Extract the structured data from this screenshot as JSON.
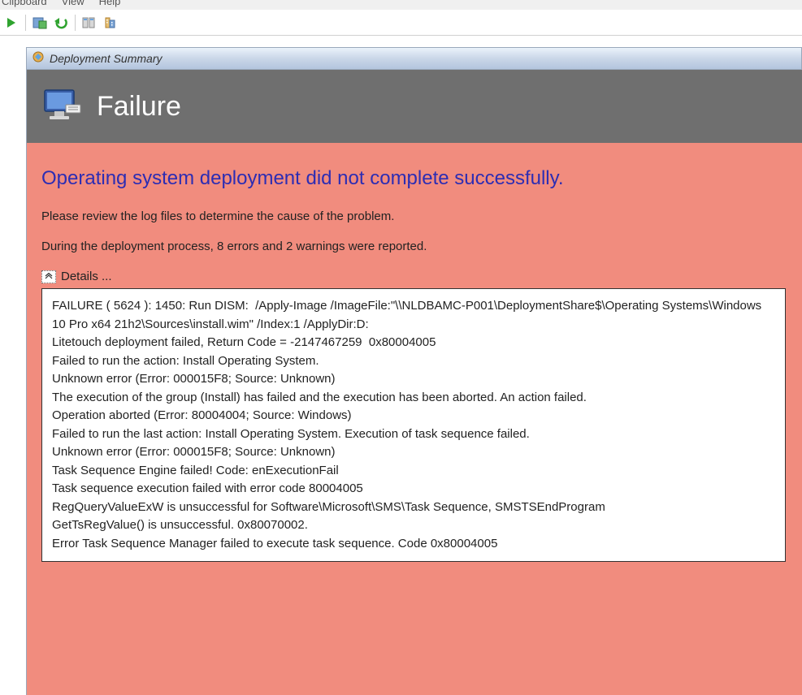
{
  "menubar": {
    "items": [
      "Clipboard",
      "View",
      "Help"
    ]
  },
  "window": {
    "title": "Deployment Summary"
  },
  "header": {
    "title": "Failure"
  },
  "content": {
    "headline": "Operating system deployment did not complete successfully.",
    "review_text": "Please review the log files to determine the cause of the problem.",
    "summary_text": "During the deployment process, 8 errors and 2 warnings were reported.",
    "details_label": "Details ...",
    "details_lines": [
      "FAILURE ( 5624 ): 1450: Run DISM:  /Apply-Image /ImageFile:\"\\\\NLDBAMC-P001\\DeploymentShare$\\Operating Systems\\Windows 10 Pro x64 21h2\\Sources\\install.wim\" /Index:1 /ApplyDir:D:",
      "Litetouch deployment failed, Return Code = -2147467259  0x80004005",
      "Failed to run the action: Install Operating System.",
      "Unknown error (Error: 000015F8; Source: Unknown)",
      "The execution of the group (Install) has failed and the execution has been aborted. An action failed.",
      "Operation aborted (Error: 80004004; Source: Windows)",
      "Failed to run the last action: Install Operating System. Execution of task sequence failed.",
      "Unknown error (Error: 000015F8; Source: Unknown)",
      "Task Sequence Engine failed! Code: enExecutionFail",
      "Task sequence execution failed with error code 80004005",
      "RegQueryValueExW is unsuccessful for Software\\Microsoft\\SMS\\Task Sequence, SMSTSEndProgram",
      "GetTsRegValue() is unsuccessful. 0x80070002.",
      "Error Task Sequence Manager failed to execute task sequence. Code 0x80004005"
    ]
  }
}
